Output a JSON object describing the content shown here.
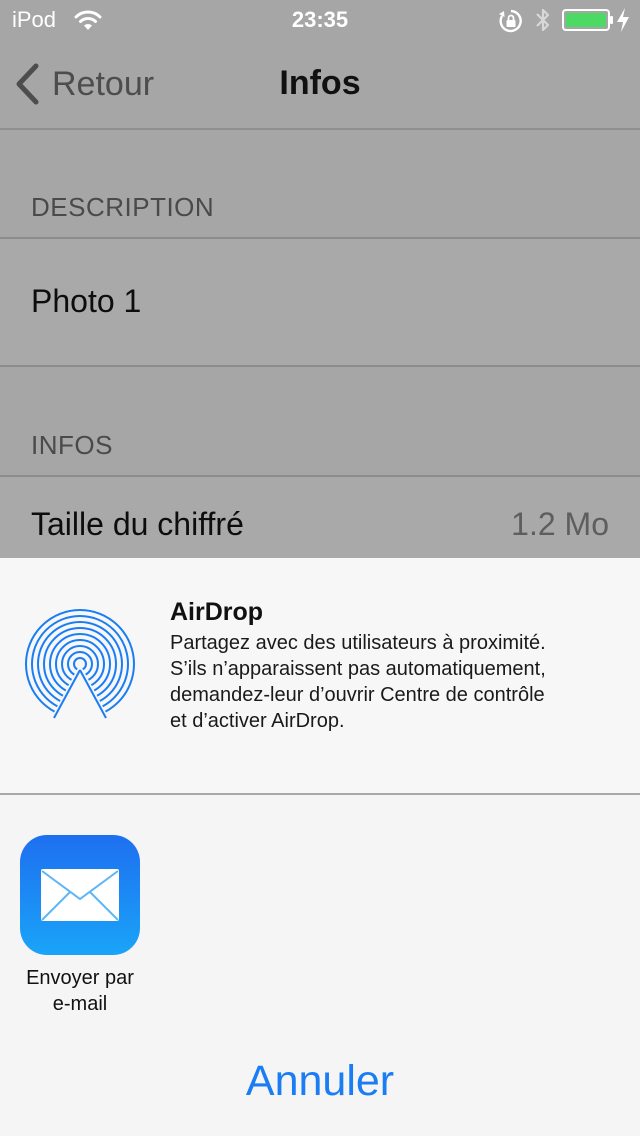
{
  "status_bar": {
    "device": "iPod",
    "time": "23:35",
    "battery_color": "#4cd964"
  },
  "nav": {
    "back_label": "Retour",
    "title": "Infos"
  },
  "table": {
    "description_header": "DESCRIPTION",
    "description_value": "Photo 1",
    "infos_header": "INFOS",
    "rows": [
      {
        "label": "Taille du chiffré",
        "value": "1.2 Mo"
      }
    ]
  },
  "share_sheet": {
    "airdrop": {
      "title": "AirDrop",
      "description_lines": [
        "Partagez avec des utilisateurs à proximité.",
        "S’ils n’apparaissent pas automatiquement,",
        "demandez-leur d’ouvrir Centre de contrôle",
        "et d’activer AirDrop."
      ],
      "icon": "airdrop-icon",
      "accent_color": "#1a7df4"
    },
    "activities": [
      {
        "label_lines": [
          "Envoyer par",
          "e-mail"
        ],
        "icon": "mail-icon"
      }
    ],
    "cancel_label": "Annuler"
  }
}
